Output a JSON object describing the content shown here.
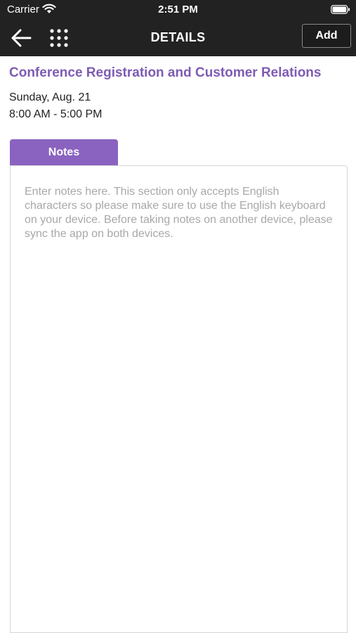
{
  "status_bar": {
    "carrier": "Carrier",
    "time": "2:51 PM",
    "icons": [
      "wifi-icon",
      "battery-icon"
    ]
  },
  "nav": {
    "title": "DETAILS",
    "add_label": "Add",
    "icons": [
      "back-arrow-icon",
      "grid-menu-icon"
    ]
  },
  "event": {
    "title": "Conference Registration and Customer Relations",
    "date": "Sunday, Aug. 21",
    "time": "8:00 AM - 5:00 PM"
  },
  "notes": {
    "tab_label": "Notes",
    "value": "",
    "placeholder": "Enter notes here. This section only accepts English characters so please make sure to use the English keyboard on your device. Before taking notes on another device, please sync the app on both devices."
  },
  "colors": {
    "accent": "#8a63c0",
    "title": "#7e5bb4",
    "bar": "#222222"
  }
}
